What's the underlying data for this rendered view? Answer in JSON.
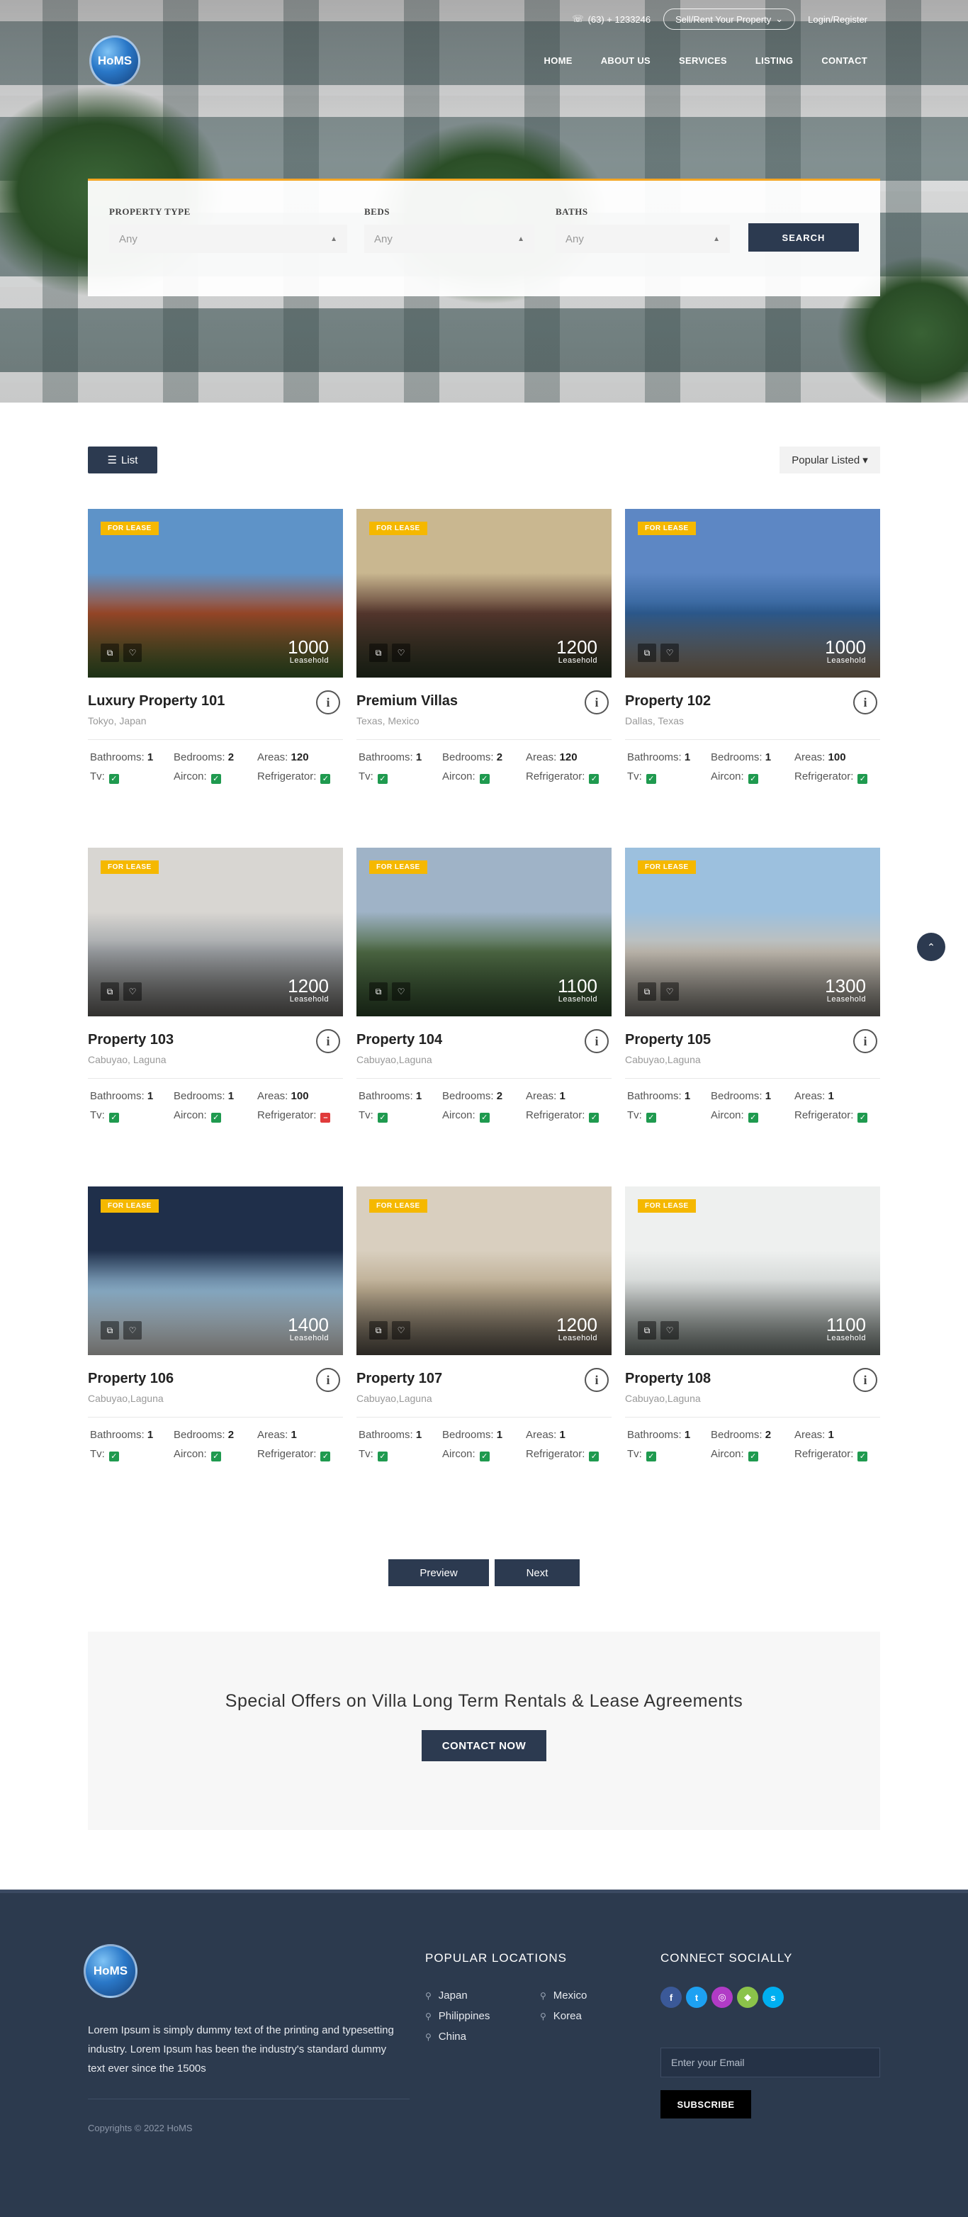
{
  "header": {
    "phone": "(63) + 1233246",
    "sell_label": "Sell/Rent Your Property",
    "login_label": "Login/Register",
    "logo_text": "HoMS",
    "nav": [
      "HOME",
      "ABOUT US",
      "SERVICES",
      "LISTING",
      "CONTACT"
    ]
  },
  "search": {
    "fields": [
      {
        "label": "PROPERTY TYPE",
        "value": "Any"
      },
      {
        "label": "BEDS",
        "value": "Any"
      },
      {
        "label": "BATHS",
        "value": "Any"
      }
    ],
    "button": "SEARCH"
  },
  "toolbar": {
    "list_label": "List",
    "sort_label": "Popular Listed"
  },
  "feature_labels": {
    "bathrooms": "Bathrooms:",
    "bedrooms": "Bedrooms:",
    "areas": "Areas:",
    "tv": "Tv:",
    "aircon": "Aircon:",
    "refrigerator": "Refrigerator:"
  },
  "listings": [
    {
      "badge": "FOR LEASE",
      "price": "1000",
      "price_sub": "Leasehold",
      "title": "Luxury Property 101",
      "location": "Tokyo, Japan",
      "bathrooms": "1",
      "bedrooms": "2",
      "areas": "120",
      "tv": true,
      "aircon": true,
      "refrigerator": true,
      "colors": [
        "#5e93c8",
        "#a14b2a",
        "#3f6b2f"
      ]
    },
    {
      "badge": "FOR LEASE",
      "price": "1200",
      "price_sub": "Leasehold",
      "title": "Premium Villas",
      "location": "Texas, Mexico",
      "bathrooms": "1",
      "bedrooms": "2",
      "areas": "120",
      "tv": true,
      "aircon": true,
      "refrigerator": true,
      "colors": [
        "#c9b790",
        "#5a3a30",
        "#2e3a26"
      ]
    },
    {
      "badge": "FOR LEASE",
      "price": "1000",
      "price_sub": "Leasehold",
      "title": "Property 102",
      "location": "Dallas, Texas",
      "bathrooms": "1",
      "bedrooms": "1",
      "areas": "100",
      "tv": true,
      "aircon": true,
      "refrigerator": true,
      "colors": [
        "#5d87c4",
        "#2f5f96",
        "#a0876a"
      ]
    },
    {
      "badge": "FOR LEASE",
      "price": "1200",
      "price_sub": "Leasehold",
      "title": "Property 103",
      "location": "Cabuyao, Laguna",
      "bathrooms": "1",
      "bedrooms": "1",
      "areas": "100",
      "tv": true,
      "aircon": true,
      "refrigerator": false,
      "colors": [
        "#d8d6d2",
        "#9ea2a6",
        "#6c6a66"
      ]
    },
    {
      "badge": "FOR LEASE",
      "price": "1100",
      "price_sub": "Leasehold",
      "title": "Property 104",
      "location": "Cabuyao,Laguna",
      "bathrooms": "1",
      "bedrooms": "2",
      "areas": "1",
      "tv": true,
      "aircon": true,
      "refrigerator": true,
      "colors": [
        "#9fb3c7",
        "#4f6b45",
        "#2f4a2b"
      ]
    },
    {
      "badge": "FOR LEASE",
      "price": "1300",
      "price_sub": "Leasehold",
      "title": "Property 105",
      "location": "Cabuyao,Laguna",
      "bathrooms": "1",
      "bedrooms": "1",
      "areas": "1",
      "tv": true,
      "aircon": true,
      "refrigerator": true,
      "colors": [
        "#9cc0de",
        "#c7c0b5",
        "#7d7a74"
      ]
    },
    {
      "badge": "FOR LEASE",
      "price": "1400",
      "price_sub": "Leasehold",
      "title": "Property 106",
      "location": "Cabuyao,Laguna",
      "bathrooms": "1",
      "bedrooms": "2",
      "areas": "1",
      "tv": true,
      "aircon": true,
      "refrigerator": true,
      "colors": [
        "#1f2f4a",
        "#8fb4cf",
        "#e8e6e2"
      ]
    },
    {
      "badge": "FOR LEASE",
      "price": "1200",
      "price_sub": "Leasehold",
      "title": "Property 107",
      "location": "Cabuyao,Laguna",
      "bathrooms": "1",
      "bedrooms": "1",
      "areas": "1",
      "tv": true,
      "aircon": true,
      "refrigerator": true,
      "colors": [
        "#d9cfbf",
        "#b9a98e",
        "#5e574e"
      ]
    },
    {
      "badge": "FOR LEASE",
      "price": "1100",
      "price_sub": "Leasehold",
      "title": "Property 108",
      "location": "Cabuyao,Laguna",
      "bathrooms": "1",
      "bedrooms": "2",
      "areas": "1",
      "tv": true,
      "aircon": true,
      "refrigerator": true,
      "colors": [
        "#eef0ef",
        "#cfd3d2",
        "#7c8580"
      ]
    }
  ],
  "pagination": {
    "prev": "Preview",
    "next": "Next"
  },
  "offer": {
    "heading": "Special Offers on Villa Long Term Rentals & Lease Agreements",
    "button": "CONTACT NOW"
  },
  "footer": {
    "logo_text": "HoMS",
    "about": "Lorem Ipsum is simply dummy text of the printing and typesetting industry. Lorem Ipsum has been the industry's standard dummy text ever since the 1500s",
    "copyright": "Copyrights © 2022 HoMS",
    "locations_title": "POPULAR LOCATIONS",
    "locations": [
      "Japan",
      "Mexico",
      "Philippines",
      "Korea",
      "China"
    ],
    "social_title": "CONNECT SOCIALLY",
    "socials": [
      {
        "icon": "facebook-icon",
        "glyph": "f",
        "color": "#3b5998"
      },
      {
        "icon": "twitter-icon",
        "glyph": "t",
        "color": "#1da1f2"
      },
      {
        "icon": "instagram-icon",
        "glyph": "◎",
        "color": "#b13bc6"
      },
      {
        "icon": "android-icon",
        "glyph": "◆",
        "color": "#8bc34a"
      },
      {
        "icon": "skype-icon",
        "glyph": "s",
        "color": "#00aff0"
      }
    ],
    "email_placeholder": "Enter your Email",
    "subscribe": "SUBSCRIBE"
  }
}
